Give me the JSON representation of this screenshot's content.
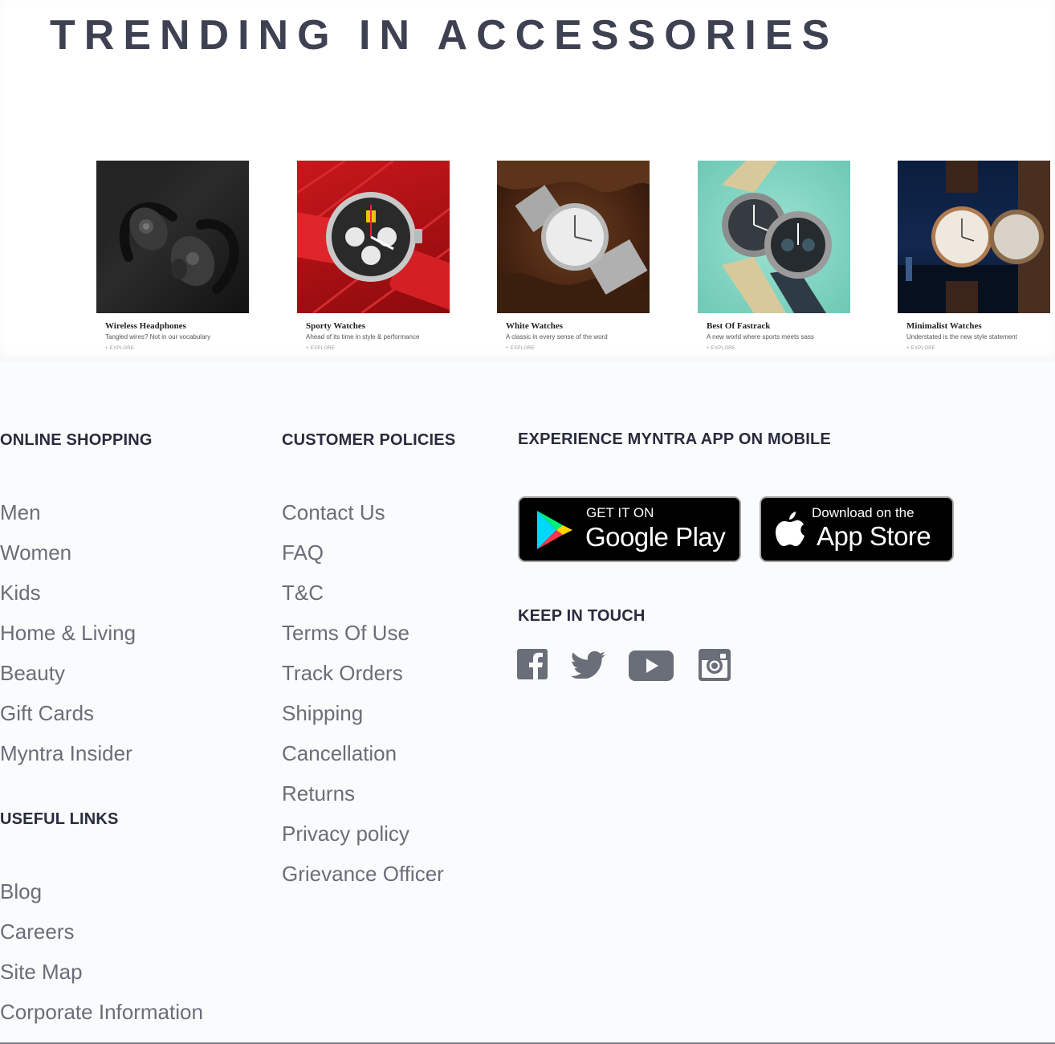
{
  "trending": {
    "title": "TRENDING IN ACCESSORIES",
    "cards": [
      {
        "title": "Wireless Headphones",
        "subtitle": "Tangled wires? Not in our vocabulary",
        "cta": "+ EXPLORE"
      },
      {
        "title": "Sporty Watches",
        "subtitle": "Ahead of its time in style & performance",
        "cta": "+ EXPLORE"
      },
      {
        "title": "White Watches",
        "subtitle": "A classic in every sense of the word",
        "cta": "+ EXPLORE"
      },
      {
        "title": "Best Of Fastrack",
        "subtitle": "A new world where sports meets sass",
        "cta": "+ EXPLORE"
      },
      {
        "title": "Minimalist Watches",
        "subtitle": "Understated is the new style statement",
        "cta": "+ EXPLORE"
      }
    ]
  },
  "footer": {
    "online_shopping": {
      "heading": "ONLINE SHOPPING",
      "links": [
        "Men",
        "Women",
        "Kids",
        "Home & Living",
        "Beauty",
        "Gift Cards",
        "Myntra Insider"
      ]
    },
    "useful_links": {
      "heading": "USEFUL LINKS",
      "links": [
        "Blog",
        "Careers",
        "Site Map",
        "Corporate Information"
      ]
    },
    "customer_policies": {
      "heading": "CUSTOMER POLICIES",
      "links": [
        "Contact Us",
        "FAQ",
        "T&C",
        "Terms Of Use",
        "Track Orders",
        "Shipping",
        "Cancellation",
        "Returns",
        "Privacy policy",
        "Grievance Officer"
      ]
    },
    "app": {
      "heading": "EXPERIENCE MYNTRA APP ON MOBILE",
      "google_play_small": "GET IT ON",
      "google_play_big": "Google Play",
      "app_store_small": "Download on the",
      "app_store_big": "App Store"
    },
    "keep_in_touch": {
      "heading": "KEEP IN TOUCH",
      "icons": [
        "facebook-icon",
        "twitter-icon",
        "youtube-icon",
        "instagram-icon"
      ]
    }
  }
}
